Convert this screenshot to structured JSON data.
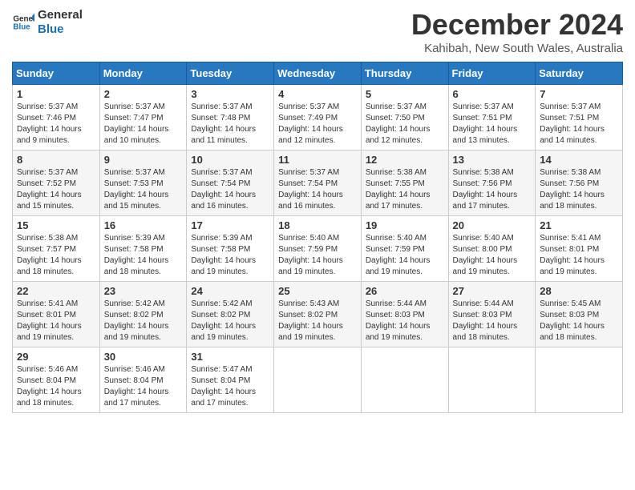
{
  "logo": {
    "line1": "General",
    "line2": "Blue"
  },
  "title": "December 2024",
  "subtitle": "Kahibah, New South Wales, Australia",
  "weekdays": [
    "Sunday",
    "Monday",
    "Tuesday",
    "Wednesday",
    "Thursday",
    "Friday",
    "Saturday"
  ],
  "weeks": [
    [
      {
        "day": "1",
        "info": "Sunrise: 5:37 AM\nSunset: 7:46 PM\nDaylight: 14 hours\nand 9 minutes."
      },
      {
        "day": "2",
        "info": "Sunrise: 5:37 AM\nSunset: 7:47 PM\nDaylight: 14 hours\nand 10 minutes."
      },
      {
        "day": "3",
        "info": "Sunrise: 5:37 AM\nSunset: 7:48 PM\nDaylight: 14 hours\nand 11 minutes."
      },
      {
        "day": "4",
        "info": "Sunrise: 5:37 AM\nSunset: 7:49 PM\nDaylight: 14 hours\nand 12 minutes."
      },
      {
        "day": "5",
        "info": "Sunrise: 5:37 AM\nSunset: 7:50 PM\nDaylight: 14 hours\nand 12 minutes."
      },
      {
        "day": "6",
        "info": "Sunrise: 5:37 AM\nSunset: 7:51 PM\nDaylight: 14 hours\nand 13 minutes."
      },
      {
        "day": "7",
        "info": "Sunrise: 5:37 AM\nSunset: 7:51 PM\nDaylight: 14 hours\nand 14 minutes."
      }
    ],
    [
      {
        "day": "8",
        "info": "Sunrise: 5:37 AM\nSunset: 7:52 PM\nDaylight: 14 hours\nand 15 minutes."
      },
      {
        "day": "9",
        "info": "Sunrise: 5:37 AM\nSunset: 7:53 PM\nDaylight: 14 hours\nand 15 minutes."
      },
      {
        "day": "10",
        "info": "Sunrise: 5:37 AM\nSunset: 7:54 PM\nDaylight: 14 hours\nand 16 minutes."
      },
      {
        "day": "11",
        "info": "Sunrise: 5:37 AM\nSunset: 7:54 PM\nDaylight: 14 hours\nand 16 minutes."
      },
      {
        "day": "12",
        "info": "Sunrise: 5:38 AM\nSunset: 7:55 PM\nDaylight: 14 hours\nand 17 minutes."
      },
      {
        "day": "13",
        "info": "Sunrise: 5:38 AM\nSunset: 7:56 PM\nDaylight: 14 hours\nand 17 minutes."
      },
      {
        "day": "14",
        "info": "Sunrise: 5:38 AM\nSunset: 7:56 PM\nDaylight: 14 hours\nand 18 minutes."
      }
    ],
    [
      {
        "day": "15",
        "info": "Sunrise: 5:38 AM\nSunset: 7:57 PM\nDaylight: 14 hours\nand 18 minutes."
      },
      {
        "day": "16",
        "info": "Sunrise: 5:39 AM\nSunset: 7:58 PM\nDaylight: 14 hours\nand 18 minutes."
      },
      {
        "day": "17",
        "info": "Sunrise: 5:39 AM\nSunset: 7:58 PM\nDaylight: 14 hours\nand 19 minutes."
      },
      {
        "day": "18",
        "info": "Sunrise: 5:40 AM\nSunset: 7:59 PM\nDaylight: 14 hours\nand 19 minutes."
      },
      {
        "day": "19",
        "info": "Sunrise: 5:40 AM\nSunset: 7:59 PM\nDaylight: 14 hours\nand 19 minutes."
      },
      {
        "day": "20",
        "info": "Sunrise: 5:40 AM\nSunset: 8:00 PM\nDaylight: 14 hours\nand 19 minutes."
      },
      {
        "day": "21",
        "info": "Sunrise: 5:41 AM\nSunset: 8:01 PM\nDaylight: 14 hours\nand 19 minutes."
      }
    ],
    [
      {
        "day": "22",
        "info": "Sunrise: 5:41 AM\nSunset: 8:01 PM\nDaylight: 14 hours\nand 19 minutes."
      },
      {
        "day": "23",
        "info": "Sunrise: 5:42 AM\nSunset: 8:02 PM\nDaylight: 14 hours\nand 19 minutes."
      },
      {
        "day": "24",
        "info": "Sunrise: 5:42 AM\nSunset: 8:02 PM\nDaylight: 14 hours\nand 19 minutes."
      },
      {
        "day": "25",
        "info": "Sunrise: 5:43 AM\nSunset: 8:02 PM\nDaylight: 14 hours\nand 19 minutes."
      },
      {
        "day": "26",
        "info": "Sunrise: 5:44 AM\nSunset: 8:03 PM\nDaylight: 14 hours\nand 19 minutes."
      },
      {
        "day": "27",
        "info": "Sunrise: 5:44 AM\nSunset: 8:03 PM\nDaylight: 14 hours\nand 18 minutes."
      },
      {
        "day": "28",
        "info": "Sunrise: 5:45 AM\nSunset: 8:03 PM\nDaylight: 14 hours\nand 18 minutes."
      }
    ],
    [
      {
        "day": "29",
        "info": "Sunrise: 5:46 AM\nSunset: 8:04 PM\nDaylight: 14 hours\nand 18 minutes."
      },
      {
        "day": "30",
        "info": "Sunrise: 5:46 AM\nSunset: 8:04 PM\nDaylight: 14 hours\nand 17 minutes."
      },
      {
        "day": "31",
        "info": "Sunrise: 5:47 AM\nSunset: 8:04 PM\nDaylight: 14 hours\nand 17 minutes."
      },
      null,
      null,
      null,
      null
    ]
  ]
}
